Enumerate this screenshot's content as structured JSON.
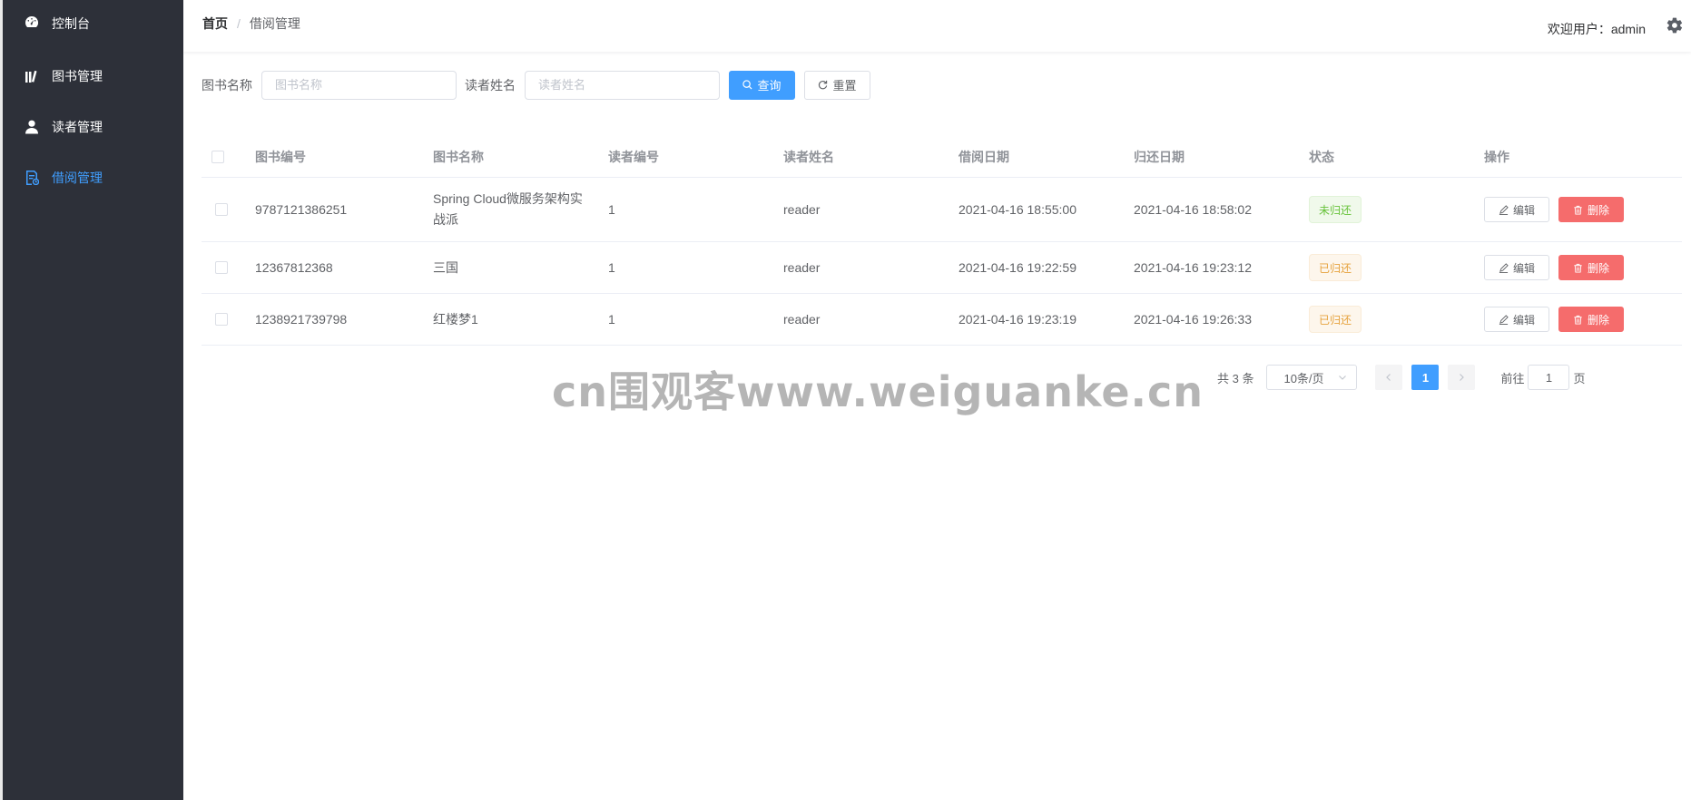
{
  "sidebar": {
    "items": [
      {
        "label": "控制台",
        "icon": "dashboard-icon",
        "active": false
      },
      {
        "label": "图书管理",
        "icon": "books-icon",
        "active": false
      },
      {
        "label": "读者管理",
        "icon": "user-icon",
        "active": false
      },
      {
        "label": "借阅管理",
        "icon": "borrow-record-icon",
        "active": true
      }
    ]
  },
  "header": {
    "breadcrumb": {
      "home": "首页",
      "separator": "/",
      "current": "借阅管理"
    },
    "welcome": "欢迎用户：admin",
    "settings_icon": "gear-icon"
  },
  "search": {
    "book_name_label": "图书名称",
    "book_name_placeholder": "图书名称",
    "reader_name_label": "读者姓名",
    "reader_name_placeholder": "读者姓名",
    "query_label": "查询",
    "reset_label": "重置"
  },
  "table": {
    "columns": [
      "图书编号",
      "图书名称",
      "读者编号",
      "读者姓名",
      "借阅日期",
      "归还日期",
      "状态",
      "操作"
    ],
    "rows": [
      {
        "book_no": "9787121386251",
        "book_name": "Spring Cloud微服务架构实战派",
        "reader_no": "1",
        "reader_name": "reader",
        "borrow_date": "2021-04-16 18:55:00",
        "return_date": "2021-04-16 18:58:02",
        "status": "未归还",
        "status_type": "success"
      },
      {
        "book_no": "12367812368",
        "book_name": "三国",
        "reader_no": "1",
        "reader_name": "reader",
        "borrow_date": "2021-04-16 19:22:59",
        "return_date": "2021-04-16 19:23:12",
        "status": "已归还",
        "status_type": "warning"
      },
      {
        "book_no": "1238921739798",
        "book_name": "红楼梦1",
        "reader_no": "1",
        "reader_name": "reader",
        "borrow_date": "2021-04-16 19:23:19",
        "return_date": "2021-04-16 19:26:33",
        "status": "已归还",
        "status_type": "warning"
      }
    ],
    "edit_label": "编辑",
    "delete_label": "删除"
  },
  "pagination": {
    "total": "共 3 条",
    "page_size": "10条/页",
    "current_page": "1",
    "goto_label": "前往",
    "goto_value": "1",
    "page_unit": "页"
  },
  "watermark": "cn围观客www.weiguanke.cn",
  "colors": {
    "sidebar_bg": "#2d3039",
    "primary": "#409eff",
    "danger": "#f56c6c",
    "success": "#67c23a",
    "warning": "#e6a23c"
  }
}
